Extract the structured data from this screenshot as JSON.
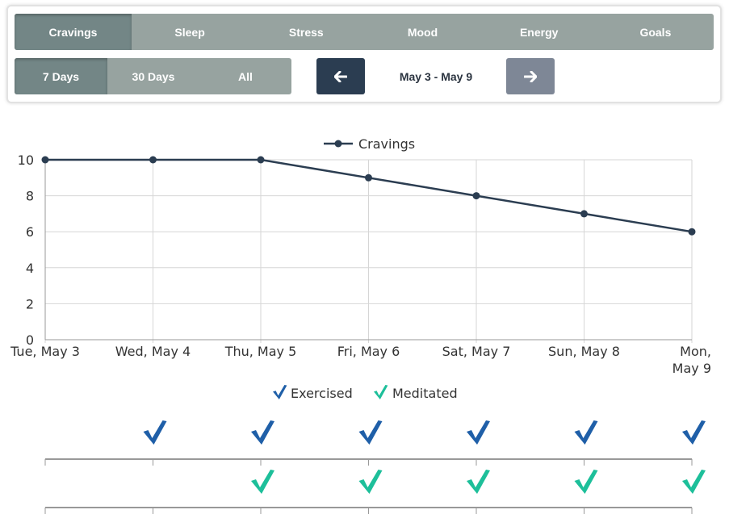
{
  "tabs": [
    {
      "label": "Cravings",
      "active": true
    },
    {
      "label": "Sleep",
      "active": false
    },
    {
      "label": "Stress",
      "active": false
    },
    {
      "label": "Mood",
      "active": false
    },
    {
      "label": "Energy",
      "active": false
    },
    {
      "label": "Goals",
      "active": false
    }
  ],
  "ranges": [
    {
      "label": "7 Days",
      "active": true
    },
    {
      "label": "30 Days",
      "active": false
    },
    {
      "label": "All",
      "active": false
    }
  ],
  "date_range": "May 3 - May 9",
  "nav": {
    "prev_icon": "arrow-left-icon",
    "next_icon": "arrow-right-icon"
  },
  "colors": {
    "line": "#2b3d51",
    "exercised": "#1f5fa8",
    "meditated": "#1dbf9a",
    "tab_bg": "#97a3a0",
    "tab_active": "#738686",
    "prev_btn": "#2b3d51",
    "next_btn": "#7e8796"
  },
  "chart_data": {
    "type": "line",
    "categories": [
      "Tue, May 3",
      "Wed, May 4",
      "Thu, May 5",
      "Fri, May 6",
      "Sat, May 7",
      "Sun, May 8",
      "Mon, May 9"
    ],
    "category_lines": [
      [
        "Tue, May 3"
      ],
      [
        "Wed, May 4"
      ],
      [
        "Thu, May 5"
      ],
      [
        "Fri, May 6"
      ],
      [
        "Sat, May 7"
      ],
      [
        "Sun, May 8"
      ],
      [
        "Mon,",
        "May 9"
      ]
    ],
    "series": [
      {
        "name": "Cravings",
        "values": [
          10,
          10,
          10,
          9,
          8,
          7,
          6
        ]
      }
    ],
    "ylim": [
      0,
      10
    ],
    "yticks": [
      "0",
      "2",
      "4",
      "6",
      "8",
      "10"
    ],
    "grid": true,
    "legend": "top-center"
  },
  "checks": {
    "legend": [
      {
        "label": "Exercised",
        "icon": "check-icon"
      },
      {
        "label": "Meditated",
        "icon": "check-icon"
      }
    ],
    "exercised": [
      false,
      true,
      true,
      true,
      true,
      true,
      true
    ],
    "meditated": [
      false,
      false,
      true,
      true,
      true,
      true,
      true
    ]
  }
}
